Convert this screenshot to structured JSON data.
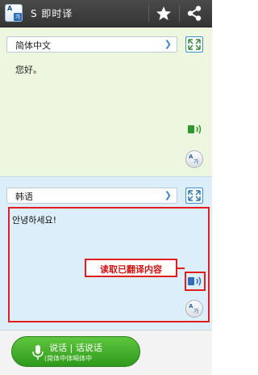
{
  "app": {
    "title": "S 即时译",
    "icon_text_a": "A",
    "icon_text_b": "가"
  },
  "source": {
    "language": "简体中文",
    "text": "您好。"
  },
  "target": {
    "language": "韩语",
    "text": "안녕하세요!"
  },
  "annotation": {
    "callout": "读取已翻译内容"
  },
  "bottom": {
    "speak_label": "说话 | 话说话",
    "speak_sub": "(简体中体喝体中"
  },
  "colors": {
    "accent_blue": "#3f92cf",
    "annotation_red": "#e11d1d",
    "speak_green": "#3ea824"
  },
  "icons": [
    "app-icon",
    "star-icon",
    "share-icon",
    "chevron-right-icon",
    "expand-icon",
    "speaker-icon",
    "swap-language-icon",
    "mic-icon"
  ]
}
